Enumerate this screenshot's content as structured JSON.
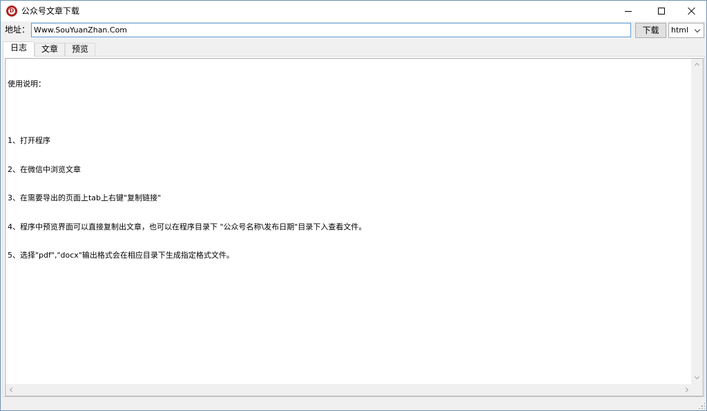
{
  "window": {
    "title": "公众号文章下载",
    "logo_letter": "D"
  },
  "address": {
    "label": "地址：",
    "value": "Www.SouYuanZhan.Com"
  },
  "toolbar": {
    "download_label": "下载",
    "format_value": "html"
  },
  "tabs": [
    {
      "label": "日志",
      "active": true
    },
    {
      "label": "文章",
      "active": false
    },
    {
      "label": "预览",
      "active": false
    }
  ],
  "log": {
    "lines": [
      "使用说明：",
      "",
      "1、打开程序",
      "2、在微信中浏览文章",
      "3、在需要导出的页面上tab上右键\"复制链接\"",
      "4、程序中预览界面可以直接复制出文章，也可以在程序目录下 \"公众号名称\\发布日期\"目录下入查看文件。",
      "5、选择\"pdf\",\"docx\"输出格式会在相应目录下生成指定格式文件。"
    ]
  }
}
